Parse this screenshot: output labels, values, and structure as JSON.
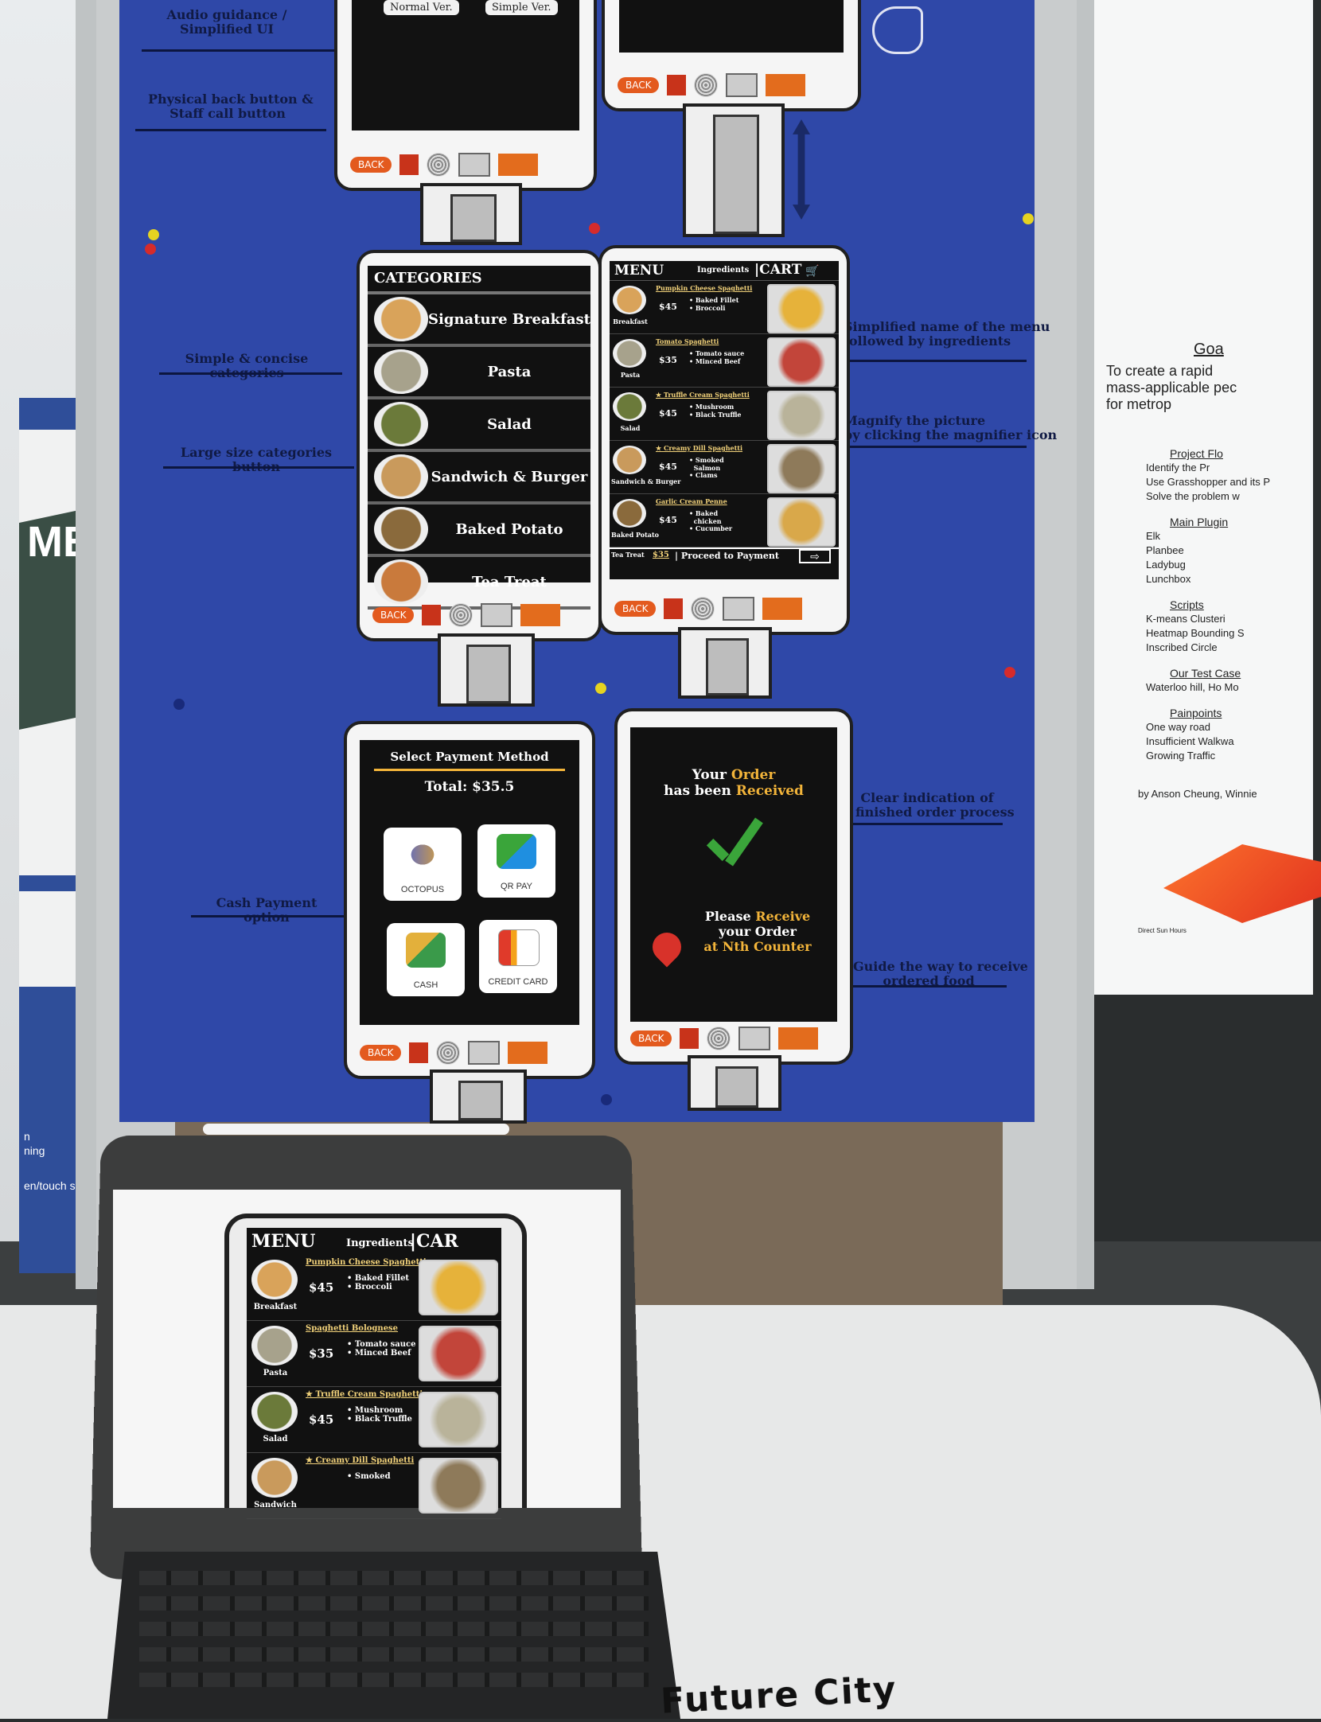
{
  "board": {
    "notes": {
      "audio_guidance": "Audio guidance /\nSimplified UI",
      "physical_back": "Physical back button &\nStaff call button",
      "simple_categories": "Simple & concise categories",
      "large_buttons": "Large size categories button",
      "simplified_name": "Simplified name of the menu\nfollowed by ingredients",
      "magnify": "Magnify the picture\nby clicking the magnifier icon",
      "cash_payment": "Cash Payment option",
      "clear_indication": "Clear indication of\nfinished order process",
      "guide_way": "Guide the way to receive\nordered food"
    },
    "top_kiosk": {
      "normal_btn": "Normal Ver.",
      "simple_btn": "Simple Ver."
    },
    "back_label": "BACK",
    "categories": {
      "title": "CATEGORIES",
      "items": [
        "Signature Breakfast",
        "Pasta",
        "Salad",
        "Sandwich & Burger",
        "Baked Potato",
        "Tea Treat"
      ]
    },
    "menu": {
      "title": "MENU",
      "ingredients_tab": "Ingredients",
      "cart_tab": "|CART",
      "items": [
        {
          "category": "Breakfast",
          "name": "Pumpkin Cheese Spaghetti",
          "price": "$45",
          "ingredients": "• Baked Fillet\n• Broccoli"
        },
        {
          "category": "Pasta",
          "name": "Tomato Spaghetti",
          "price": "$35",
          "ingredients": "• Tomato sauce\n• Minced Beef"
        },
        {
          "category": "Salad",
          "name": "★ Truffle Cream Spaghetti",
          "price": "$45",
          "ingredients": "• Mushroom\n• Black Truffle"
        },
        {
          "category": "Sandwich & Burger",
          "name": "★ Creamy Dill Spaghetti",
          "price": "$45",
          "ingredients": "• Smoked\n  Salmon\n• Clams"
        },
        {
          "category": "Baked Potato",
          "name": "Garlic Cream Penne",
          "price": "$45",
          "ingredients": "• Baked\n  chicken\n• Cucumber"
        }
      ],
      "last_category": "Tea Treat",
      "total": "$35",
      "proceed": "| Proceed to Payment"
    },
    "payment": {
      "title": "Select Payment Method",
      "total": "Total: $35.5",
      "options": [
        "OCTOPUS",
        "QR PAY",
        "CASH",
        "CREDIT CARD"
      ]
    },
    "received": {
      "line1": "Your ",
      "line1_hl": "Order",
      "line2": "has been ",
      "line2_hl": "Received",
      "please": "Please ",
      "please_hl": "Receive",
      "your_order": "your Order",
      "at": "at ",
      "counter_hl": "Nth Counter"
    }
  },
  "right_poster": {
    "goal": "Goa",
    "goal_text": "To create a rapid\nmass-applicable pec\nfor metrop",
    "sections": [
      {
        "head": "Project Flo",
        "lines": [
          "Identify the Pr",
          "Use Grasshopper and its P",
          "Solve the problem w"
        ]
      },
      {
        "head": "Main Plugin",
        "lines": [
          "Elk",
          "Planbee",
          "Ladybug",
          "Lunchbox"
        ]
      },
      {
        "head": "Scripts",
        "lines": [
          "K-means Clusteri",
          "Heatmap Bounding S",
          "Inscribed Circle"
        ]
      },
      {
        "head": "Our Test Case",
        "lines": [
          "Waterloo hill, Ho Mo"
        ]
      },
      {
        "head": "Painpoints",
        "lines": [
          "One way road",
          "Insufficient Walkwa",
          "Growing Traffic"
        ]
      }
    ],
    "credits": "by Anson Cheung, Winnie",
    "map_caption": "Direct Sun Hours"
  },
  "left_poster": {
    "big": "ME",
    "fragments": [
      "n",
      "ning",
      "en/touch scre"
    ]
  },
  "ipad": {
    "menu": "MENU",
    "ingredients": "Ingredients",
    "cart": "|CAR",
    "rows": [
      {
        "category": "Breakfast",
        "name": "Pumpkin Cheese Spaghetti",
        "price": "$45",
        "ingredients": "• Baked Fillet\n• Broccoli"
      },
      {
        "category": "Pasta",
        "name": "Spaghetti Bolognese",
        "price": "$35",
        "ingredients": "• Tomato sauce\n• Minced Beef"
      },
      {
        "category": "Salad",
        "name": "★ Truffle Cream Spaghetti",
        "price": "$45",
        "ingredients": "• Mushroom\n• Black Truffle"
      },
      {
        "category": "Sandwich",
        "name": "★ Creamy Dill Spaghetti",
        "price": "",
        "ingredients": "• Smoked"
      }
    ]
  },
  "table_label": "Future City",
  "colors": {
    "board_blue": "#2f48a8",
    "kiosk_orange": "#e35a1e",
    "accent_gold": "#f2b43a",
    "check_green": "#3aa53a"
  }
}
